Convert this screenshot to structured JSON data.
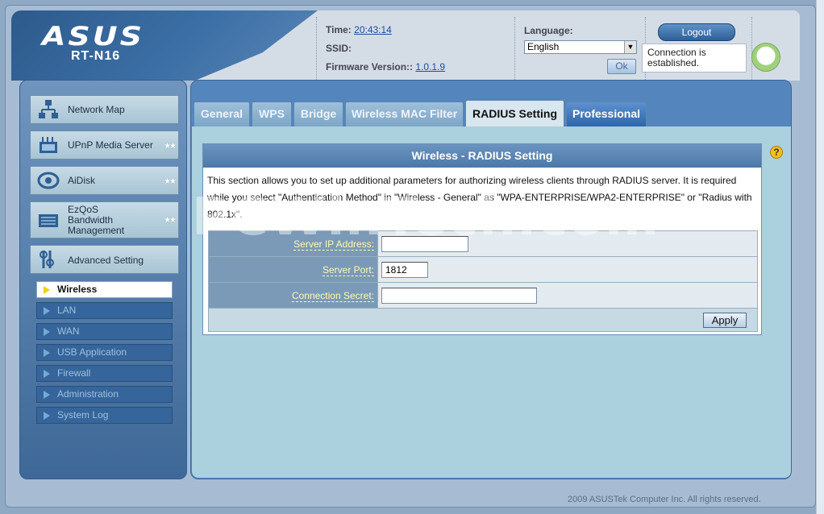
{
  "brand": {
    "logo": "ASUS",
    "model": "RT-N16"
  },
  "header": {
    "time_label": "Time:",
    "time_value": "20:43:14",
    "ssid_label": "SSID:",
    "firmware_label": "Firmware Version::",
    "firmware_value": "1.0.1.9",
    "language_label": "Language:",
    "language_value": "English",
    "ok_label": "Ok",
    "logout_label": "Logout",
    "connection_status": "Connection is established."
  },
  "nav": {
    "items": [
      {
        "label": "Network Map",
        "icon": "network-map-icon"
      },
      {
        "label": "UPnP Media Server",
        "icon": "media-server-icon"
      },
      {
        "label": "AiDisk",
        "icon": "aidisk-icon"
      },
      {
        "label": "EzQoS Bandwidth Management",
        "icon": "ezqos-icon"
      },
      {
        "label": "Advanced Setting",
        "icon": "advanced-setting-icon"
      }
    ],
    "sub": [
      "Wireless",
      "LAN",
      "WAN",
      "USB Application",
      "Firewall",
      "Administration",
      "System Log"
    ]
  },
  "tabs": [
    "General",
    "WPS",
    "Bridge",
    "Wireless MAC Filter",
    "RADIUS Setting",
    "Professional"
  ],
  "panel": {
    "title": "Wireless - RADIUS Setting",
    "description": "This section allows you to set up additional parameters for authorizing wireless clients through RADIUS server. It is required while you select \"Authentication Method\" in \"Wireless - General\" as \"WPA-ENTERPRISE/WPA2-ENTERPRISE\" or \"Radius with 802.1x\".",
    "fields": {
      "server_ip_label": "Server IP Address:",
      "server_ip_value": "",
      "server_port_label": "Server Port:",
      "server_port_value": "1812",
      "secret_label": "Connection Secret:",
      "secret_value": ""
    },
    "apply_label": "Apply"
  },
  "watermark": "PCWinTech.com",
  "footer": {
    "copyright": "2009 ASUSTek Computer Inc. All rights reserved."
  },
  "colors": {
    "accent": "#3c6fa6",
    "active_tab": "#d8e6ee",
    "label_text": "#fff9b5"
  }
}
